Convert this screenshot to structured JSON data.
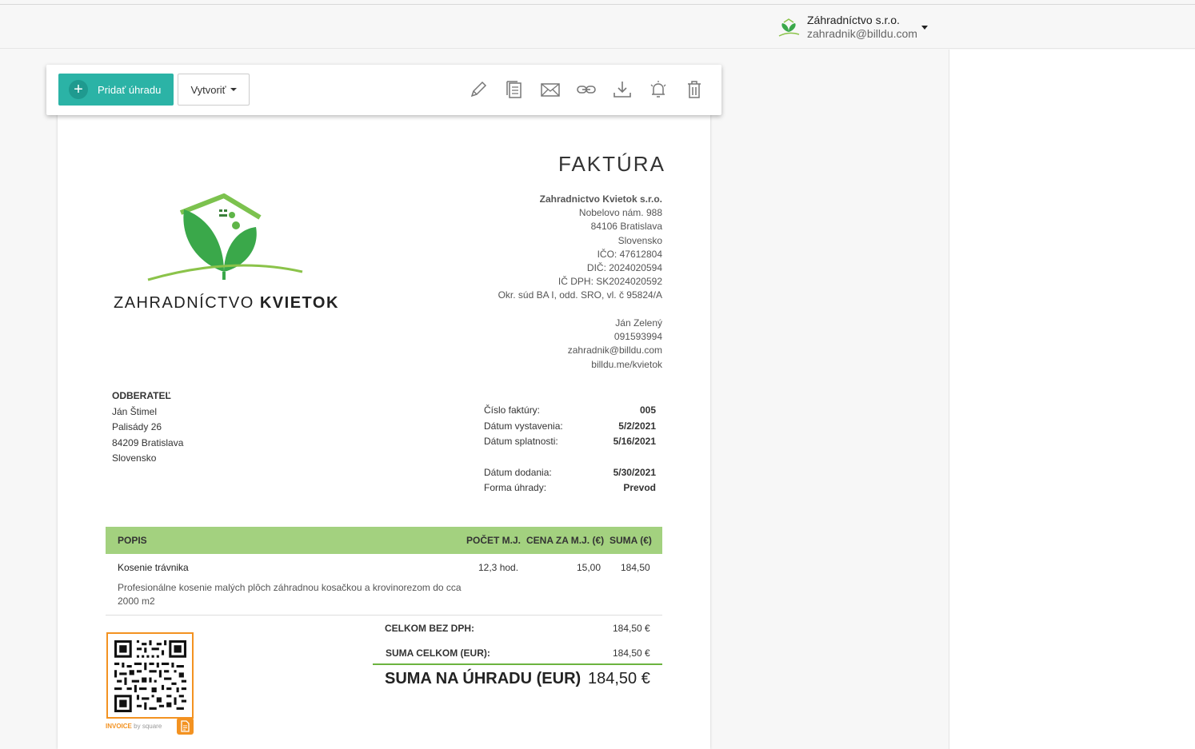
{
  "account": {
    "name": "Záhradníctvo s.r.o.",
    "email": "zahradnik@billdu.com"
  },
  "toolbar": {
    "pay_label": "Pridať úhradu",
    "create_label": "Vytvoriť",
    "icons": [
      "edit-icon",
      "copy-icon",
      "email-icon",
      "link-icon",
      "download-icon",
      "reminder-bell-icon",
      "trash-icon"
    ]
  },
  "invoice": {
    "title": "FAKTÚRA",
    "logo_text_regular": "ZAHRADNÍCTVO",
    "logo_text_bold": "KVIETOK",
    "seller": {
      "name": "Zahradnictvo Kvietok s.r.o.",
      "street": "Nobelovo nám. 988",
      "city": "84106 Bratislava",
      "country": "Slovensko",
      "ico": "IČO: 47612804",
      "dic": "DIČ: 2024020594",
      "icdph": "IČ DPH: SK2024020592",
      "register": "Okr. súd BA I, odd. SRO, vl. č 95824/A"
    },
    "contact": {
      "person": "Ján Zelený",
      "phone": "091593994",
      "email": "zahradnik@billdu.com",
      "web": "billdu.me/kvietok"
    },
    "buyer": {
      "label": "ODBERATEĽ",
      "name": "Ján Štimel",
      "street": "Palisády 26",
      "city": "84209 Bratislava",
      "country": "Slovensko"
    },
    "meta": {
      "number_label": "Číslo faktúry:",
      "number": "005",
      "issued_label": "Dátum vystavenia:",
      "issued": "5/2/2021",
      "due_label": "Dátum splatnosti:",
      "due": "5/16/2021",
      "delivery_label": "Dátum dodania:",
      "delivery": "5/30/2021",
      "payment_label": "Forma úhrady:",
      "payment": "Prevod"
    },
    "table": {
      "headers": {
        "desc": "POPIS",
        "qty": "POČET M.J.",
        "price": "CENA ZA M.J. (€)",
        "sum": "SUMA (€)"
      },
      "items": [
        {
          "name": "Kosenie trávnika",
          "description": "Profesionálne kosenie malých plôch záhradnou kosačkou a krovinorezom do cca 2000 m2",
          "qty": "12,3 hod.",
          "price": "15,00",
          "sum": "184,50"
        }
      ]
    },
    "totals": {
      "net_label": "CELKOM BEZ DPH:",
      "net": "184,50 €",
      "total_label": "SUMA CELKOM (EUR):",
      "total": "184,50 €",
      "due_label": "SUMA NA ÚHRADU (EUR)",
      "due": "184,50 €"
    },
    "qr": {
      "brand": "INVOICE",
      "by": "by square"
    }
  },
  "colors": {
    "accent": "#2bb3a6",
    "table_header": "#a3d17f",
    "green_line": "#6cb33f",
    "qr_orange": "#f39221"
  }
}
